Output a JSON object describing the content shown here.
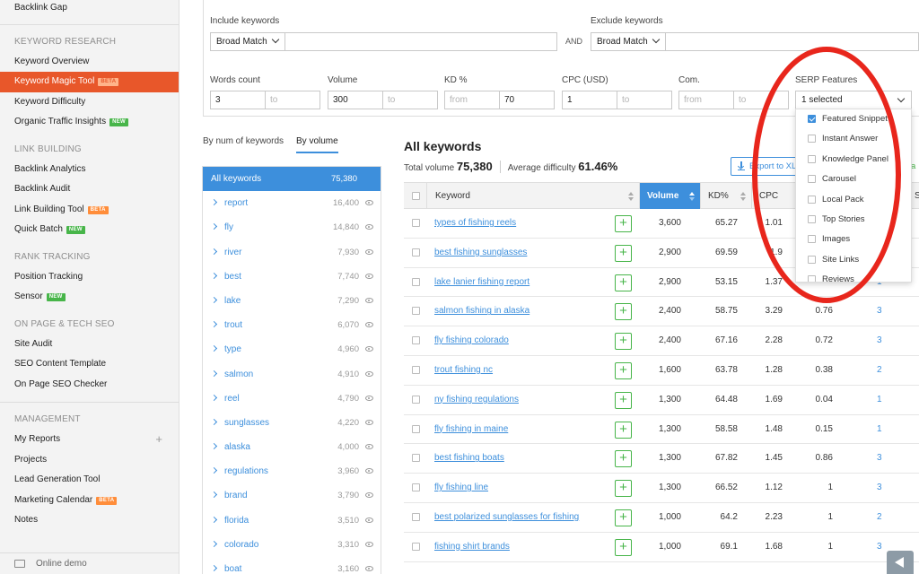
{
  "sidebar": {
    "top_item": "Backlink Gap",
    "sections": [
      {
        "title": "KEYWORD RESEARCH",
        "items": [
          {
            "label": "Keyword Overview",
            "badge": ""
          },
          {
            "label": "Keyword Magic Tool",
            "badge": "BETA",
            "active": true
          },
          {
            "label": "Keyword Difficulty",
            "badge": ""
          },
          {
            "label": "Organic Traffic Insights",
            "badge": "NEW"
          }
        ]
      },
      {
        "title": "LINK BUILDING",
        "items": [
          {
            "label": "Backlink Analytics",
            "badge": ""
          },
          {
            "label": "Backlink Audit",
            "badge": ""
          },
          {
            "label": "Link Building Tool",
            "badge": "BETA"
          },
          {
            "label": "Quick Batch",
            "badge": "NEW"
          }
        ]
      },
      {
        "title": "RANK TRACKING",
        "items": [
          {
            "label": "Position Tracking",
            "badge": ""
          },
          {
            "label": "Sensor",
            "badge": "NEW"
          }
        ]
      },
      {
        "title": "ON PAGE & TECH SEO",
        "items": [
          {
            "label": "Site Audit",
            "badge": ""
          },
          {
            "label": "SEO Content Template",
            "badge": ""
          },
          {
            "label": "On Page SEO Checker",
            "badge": ""
          }
        ]
      },
      {
        "title": "MANAGEMENT",
        "items": [
          {
            "label": "My Reports",
            "badge": "",
            "plus": "+"
          },
          {
            "label": "Projects",
            "badge": ""
          },
          {
            "label": "Lead Generation Tool",
            "badge": ""
          },
          {
            "label": "Marketing Calendar",
            "badge": "BETA"
          },
          {
            "label": "Notes",
            "badge": ""
          }
        ]
      }
    ],
    "footer": "Online demo"
  },
  "filters": {
    "include_label": "Include keywords",
    "include_match": "Broad Match",
    "include_value": "",
    "and_label": "AND",
    "exclude_label": "Exclude keywords",
    "exclude_match": "Broad Match",
    "exclude_value": "",
    "words_count": {
      "label": "Words count",
      "from": "3",
      "to_placeholder": "to"
    },
    "volume": {
      "label": "Volume",
      "from": "300",
      "to_placeholder": "to"
    },
    "kd": {
      "label": "KD %",
      "from_placeholder": "from",
      "to": "70"
    },
    "cpc": {
      "label": "CPC (USD)",
      "from": "1",
      "to_placeholder": "to"
    },
    "com": {
      "label": "Com.",
      "from_placeholder": "from",
      "to_placeholder": "to"
    },
    "serp": {
      "label": "SERP Features",
      "selected": "1 selected"
    }
  },
  "serp_options": [
    {
      "label": "Featured Snippet",
      "checked": true
    },
    {
      "label": "Instant Answer",
      "checked": false
    },
    {
      "label": "Knowledge Panel",
      "checked": false
    },
    {
      "label": "Carousel",
      "checked": false
    },
    {
      "label": "Local Pack",
      "checked": false
    },
    {
      "label": "Top Stories",
      "checked": false
    },
    {
      "label": "Images",
      "checked": false
    },
    {
      "label": "Site Links",
      "checked": false
    },
    {
      "label": "Reviews",
      "checked": false
    }
  ],
  "breakdown": {
    "tab_num": "By num of keywords",
    "tab_volume": "By volume",
    "all": {
      "label": "All keywords",
      "count": "75,380"
    },
    "groups": [
      {
        "label": "report",
        "count": "16,400"
      },
      {
        "label": "fly",
        "count": "14,840"
      },
      {
        "label": "river",
        "count": "7,930"
      },
      {
        "label": "best",
        "count": "7,740"
      },
      {
        "label": "lake",
        "count": "7,290"
      },
      {
        "label": "trout",
        "count": "6,070"
      },
      {
        "label": "type",
        "count": "4,960"
      },
      {
        "label": "salmon",
        "count": "4,910"
      },
      {
        "label": "reel",
        "count": "4,790"
      },
      {
        "label": "sunglasses",
        "count": "4,220"
      },
      {
        "label": "alaska",
        "count": "4,000"
      },
      {
        "label": "regulations",
        "count": "3,960"
      },
      {
        "label": "brand",
        "count": "3,790"
      },
      {
        "label": "florida",
        "count": "3,510"
      },
      {
        "label": "colorado",
        "count": "3,310"
      },
      {
        "label": "boat",
        "count": "3,160"
      }
    ]
  },
  "keywords": {
    "title": "All keywords",
    "total_label": "Total volume",
    "total_value": "75,380",
    "avg_label": "Average difficulty",
    "avg_value": "61.46%",
    "export_label": "Export to XL",
    "export_tail": "a",
    "headers": {
      "keyword": "Keyword",
      "volume": "Volume",
      "kd": "KD%",
      "cpc": "CPC",
      "s": "S"
    },
    "rows": [
      {
        "keyword": "types of fishing reels",
        "volume": "3,600",
        "kd": "65.27",
        "cpc": "1.01",
        "com": "",
        "results": ""
      },
      {
        "keyword": "best fishing sunglasses",
        "volume": "2,900",
        "kd": "69.59",
        "cpc": "1.9",
        "com": "",
        "results": ""
      },
      {
        "keyword": "lake lanier fishing report",
        "volume": "2,900",
        "kd": "53.15",
        "cpc": "1.37",
        "com": "",
        "results": "1"
      },
      {
        "keyword": "salmon fishing in alaska",
        "volume": "2,400",
        "kd": "58.75",
        "cpc": "3.29",
        "com": "0.76",
        "results": "3"
      },
      {
        "keyword": "fly fishing colorado",
        "volume": "2,400",
        "kd": "67.16",
        "cpc": "2.28",
        "com": "0.72",
        "results": "3"
      },
      {
        "keyword": "trout fishing nc",
        "volume": "1,600",
        "kd": "63.78",
        "cpc": "1.28",
        "com": "0.38",
        "results": "2"
      },
      {
        "keyword": "ny fishing regulations",
        "volume": "1,300",
        "kd": "64.48",
        "cpc": "1.69",
        "com": "0.04",
        "results": "1"
      },
      {
        "keyword": "fly fishing in maine",
        "volume": "1,300",
        "kd": "58.58",
        "cpc": "1.48",
        "com": "0.15",
        "results": "1"
      },
      {
        "keyword": "best fishing boats",
        "volume": "1,300",
        "kd": "67.82",
        "cpc": "1.45",
        "com": "0.86",
        "results": "3"
      },
      {
        "keyword": "fly fishing line",
        "volume": "1,300",
        "kd": "66.52",
        "cpc": "1.12",
        "com": "1",
        "results": "3"
      },
      {
        "keyword": "best polarized sunglasses for fishing",
        "volume": "1,000",
        "kd": "64.2",
        "cpc": "2.23",
        "com": "1",
        "results": "2"
      },
      {
        "keyword": "fishing shirt brands",
        "volume": "1,000",
        "kd": "69.1",
        "cpc": "1.68",
        "com": "1",
        "results": "3"
      }
    ]
  },
  "colors": {
    "accent": "#3d8fdc",
    "brand": "#e8572a",
    "annotation": "#e8261c",
    "add": "#47b549"
  }
}
